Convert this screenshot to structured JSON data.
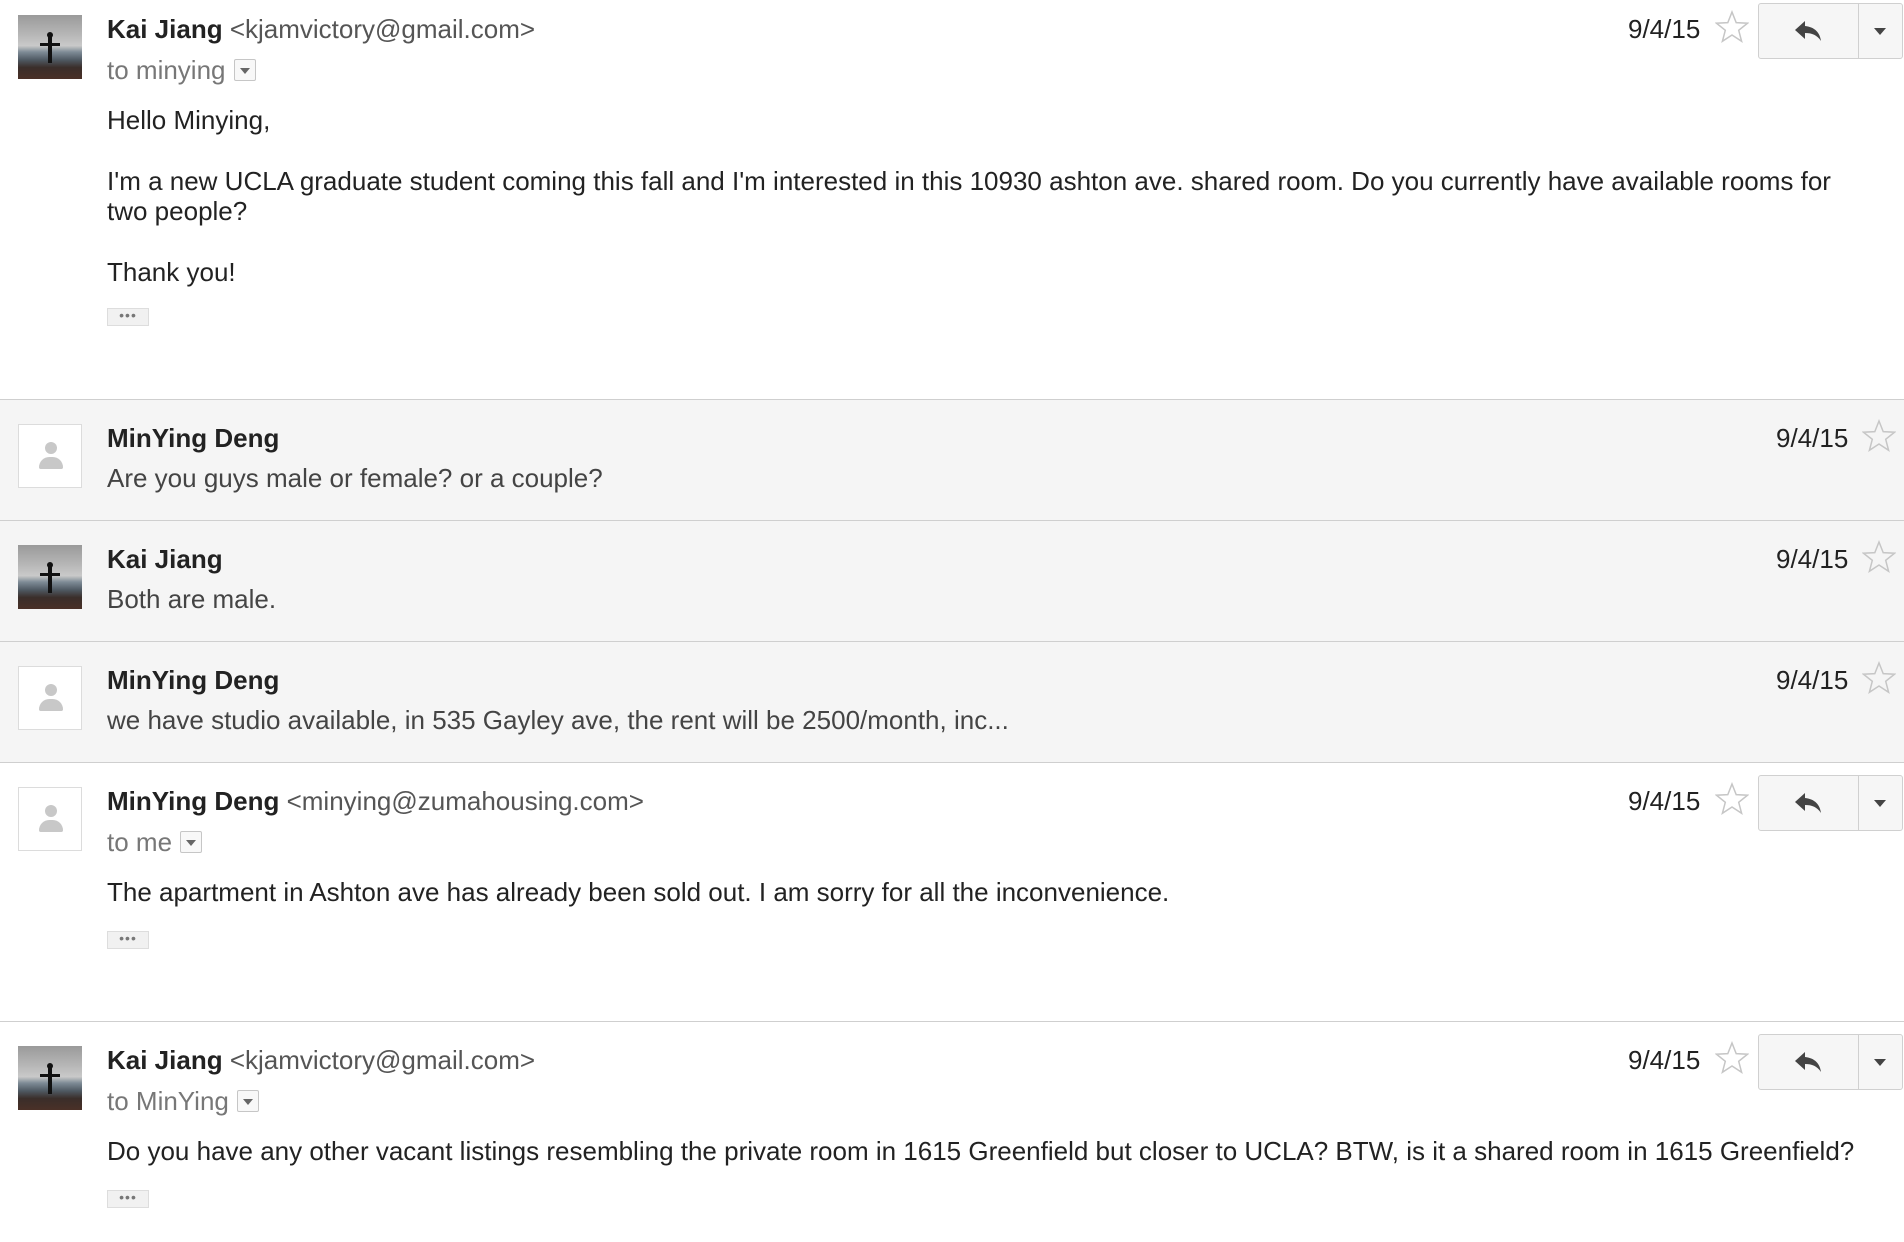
{
  "messages": [
    {
      "state": "expanded",
      "sender_name": "Kai Jiang",
      "sender_email": "<kjamvictory@gmail.com>",
      "to": "to minying",
      "date": "9/4/15",
      "body": [
        "Hello Minying,",
        "I'm a new UCLA graduate student coming this fall and I'm interested in this 10930 ashton ave. shared room. Do you currently have available rooms for two people?",
        "Thank you!"
      ],
      "dots": "•••",
      "avatar": "photo"
    },
    {
      "state": "collapsed",
      "sender_name": "MinYing Deng",
      "date": "9/4/15",
      "snippet": "Are you guys male or female? or a couple?",
      "avatar": "blank"
    },
    {
      "state": "collapsed",
      "sender_name": "Kai Jiang",
      "date": "9/4/15",
      "snippet": "Both are male.",
      "avatar": "photo"
    },
    {
      "state": "collapsed",
      "sender_name": "MinYing Deng",
      "date": "9/4/15",
      "snippet": "we have studio available, in 535 Gayley ave, the rent will be 2500/month, inc...",
      "avatar": "blank"
    },
    {
      "state": "expanded",
      "sender_name": "MinYing Deng",
      "sender_email": "<minying@zumahousing.com>",
      "to": "to me",
      "date": "9/4/15",
      "body": [
        "The apartment in Ashton ave has already been sold out. I am sorry for all the inconvenience."
      ],
      "dots": "•••",
      "avatar": "blank"
    },
    {
      "state": "expanded",
      "sender_name": "Kai Jiang",
      "sender_email": "<kjamvictory@gmail.com>",
      "to": "to MinYing",
      "date": "9/4/15",
      "body": [
        "Do you have any other vacant listings resembling the private room in 1615 Greenfield but closer to UCLA? BTW, is it a shared room in 1615 Greenfield?"
      ],
      "dots": "•••",
      "avatar": "photo"
    }
  ],
  "icons": {
    "star": "star-outline-icon",
    "reply": "reply-arrow-icon",
    "more": "caret-down-icon",
    "to_dropdown": "caret-down-icon"
  },
  "colors": {
    "collapsed_bg": "#f5f5f5",
    "divider": "#cfcfcf",
    "star_outline": "#c6c6c6"
  }
}
